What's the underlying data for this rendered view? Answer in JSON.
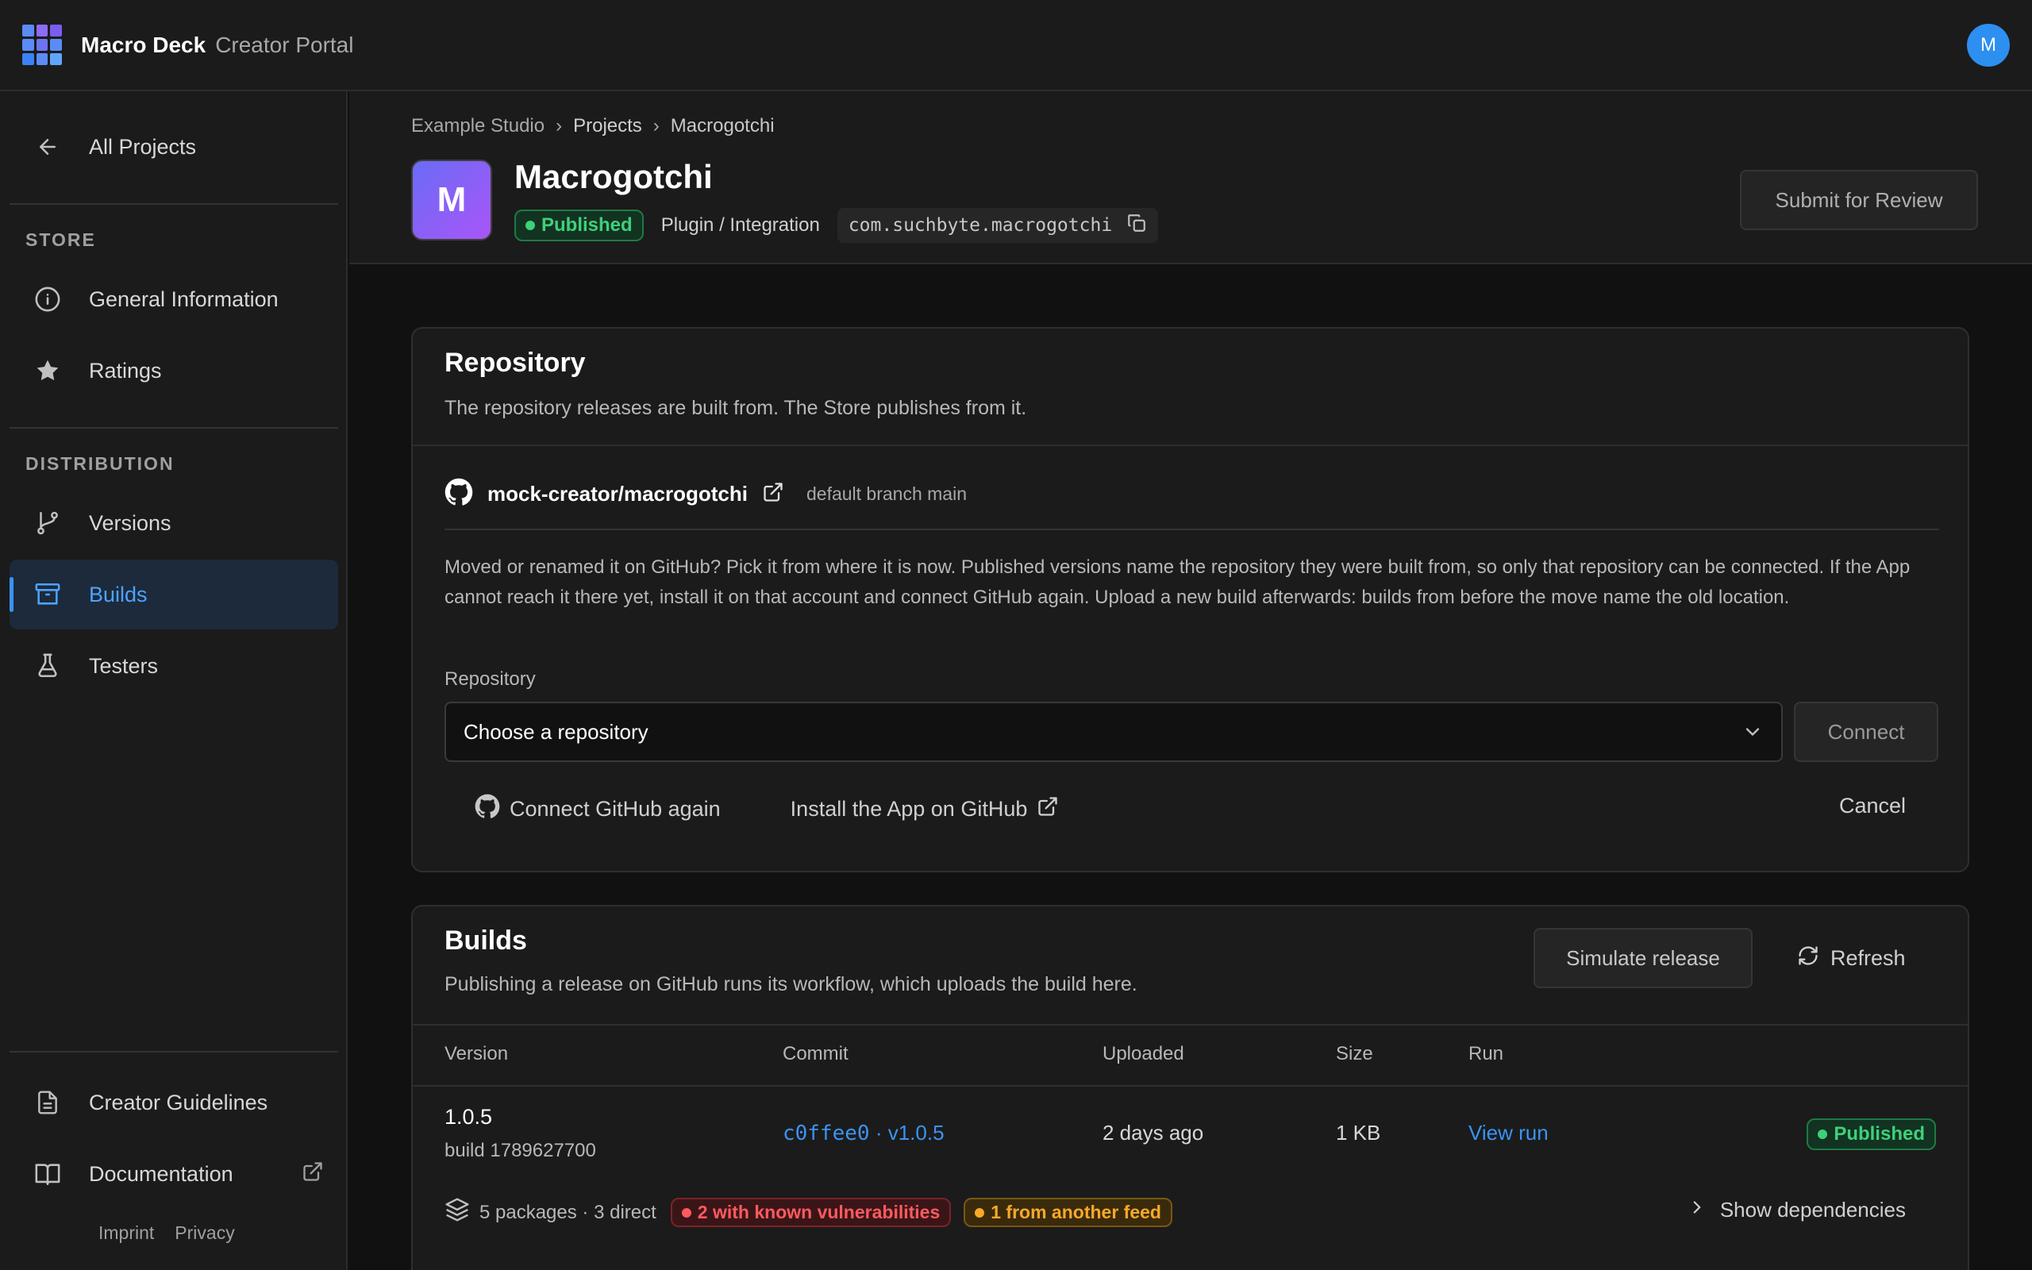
{
  "app": {
    "brand": "Macro Deck",
    "brand_sub": "Creator Portal",
    "user_initial": "M"
  },
  "sidebar": {
    "back_label": "All Projects",
    "store_label": "STORE",
    "store_items": [
      {
        "label": "General Information",
        "icon": "info-icon"
      },
      {
        "label": "Ratings",
        "icon": "star-icon"
      }
    ],
    "distribution_label": "DISTRIBUTION",
    "distribution_items": [
      {
        "label": "Versions",
        "icon": "branch-icon"
      },
      {
        "label": "Builds",
        "icon": "archive-icon",
        "active": true
      },
      {
        "label": "Testers",
        "icon": "flask-icon"
      }
    ],
    "bottom_items": [
      {
        "label": "Creator Guidelines",
        "icon": "document-icon"
      },
      {
        "label": "Documentation",
        "icon": "book-icon"
      }
    ],
    "footer": {
      "imprint": "Imprint",
      "privacy": "Privacy"
    }
  },
  "header": {
    "breadcrumb": [
      "Example Studio",
      "Projects",
      "Macrogotchi"
    ],
    "separator": "›",
    "avatar_initial": "M",
    "title": "Macrogotchi",
    "status": "Published",
    "type": "Plugin / Integration",
    "package_id": "com.suchbyte.macrogotchi",
    "submit_label": "Submit for Review"
  },
  "repository": {
    "title": "Repository",
    "description": "The repository releases are built from. The Store publishes from it.",
    "repo_name": "mock-creator/macrogotchi",
    "branch": "default branch main",
    "notice": "Moved or renamed it on GitHub? Pick it from where it is now. Published versions name the repository they were built from, so only that repository can be connected. If the App cannot reach it there yet, install it on that account and connect GitHub again. Upload a new build afterwards: builds from before the move name the old location.",
    "field_label": "Repository",
    "select_value": "Choose a repository",
    "connect_label": "Connect",
    "reconnect_label": "Connect GitHub again",
    "install_label": "Install the App on GitHub",
    "cancel_label": "Cancel"
  },
  "builds": {
    "title": "Builds",
    "description": "Publishing a release on GitHub runs its workflow, which uploads the build here.",
    "simulate_label": "Simulate release",
    "refresh_label": "Refresh",
    "columns": [
      "Version",
      "Commit",
      "Uploaded",
      "Size",
      "Run"
    ],
    "rows": [
      {
        "version": "1.0.5",
        "build": "build 1789627700",
        "commit": "c0ffee0",
        "commit_sep": "·",
        "tag": "v1.0.5",
        "uploaded": "2 days ago",
        "size": "1 KB",
        "run": "View run",
        "status": "Published",
        "deps_summary": "5 packages · 3 direct",
        "vuln_badge": "2 with known vulnerabilities",
        "feed_badge": "1 from another feed",
        "show_deps": "Show dependencies"
      }
    ]
  },
  "colors": {
    "accent": "#3b93f5",
    "success": "#3fd07a",
    "danger": "#ff5a5f",
    "warning": "#f7a928",
    "background": "#111111",
    "surface": "#1b1b1b"
  }
}
